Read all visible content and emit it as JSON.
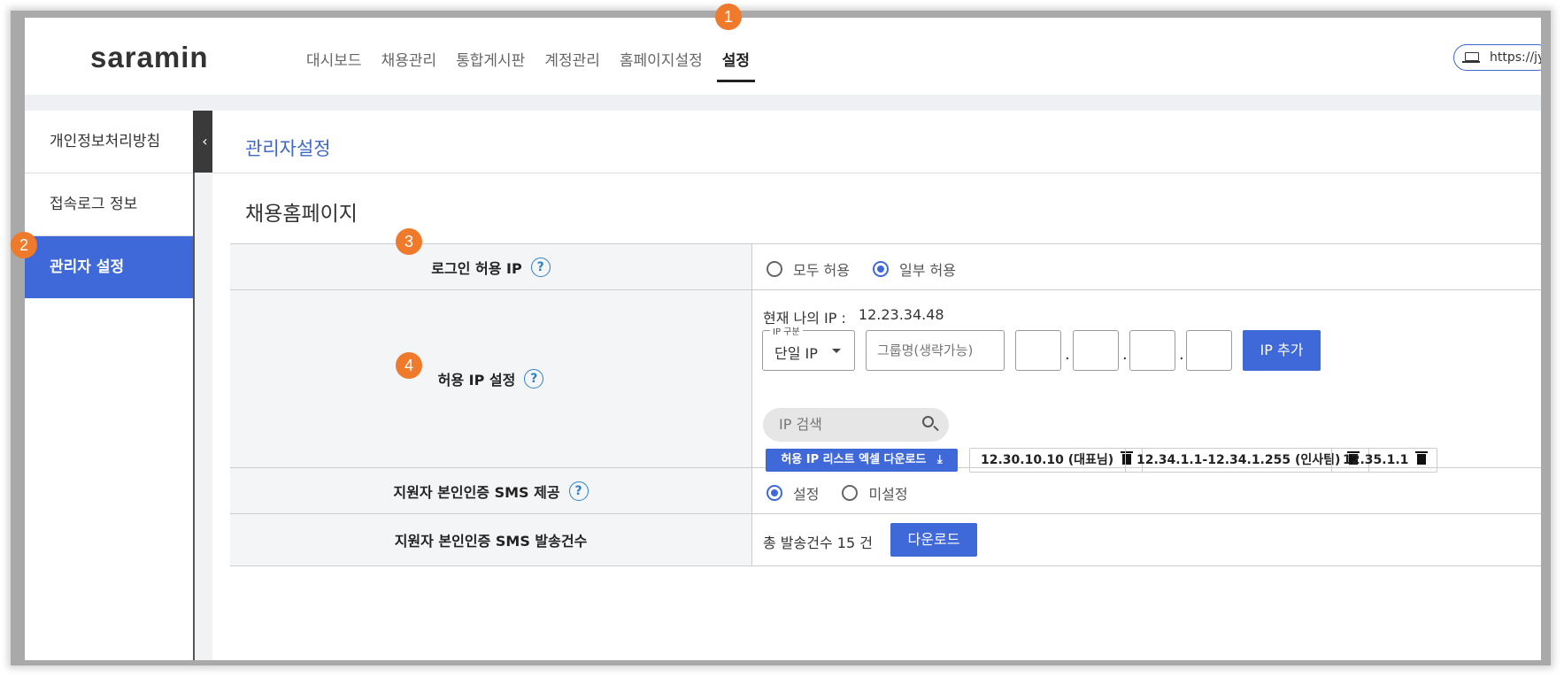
{
  "header": {
    "logo": "saramin",
    "nav": [
      "대시보드",
      "채용관리",
      "통합게시판",
      "계정관리",
      "홈페이지설정",
      "설정"
    ],
    "active_nav": "설정",
    "url": "https://jy"
  },
  "sidebar": {
    "items": [
      "개인정보처리방침",
      "접속로그 정보",
      "관리자 설정"
    ],
    "active": "관리자 설정",
    "collapse_glyph": "‹"
  },
  "main": {
    "breadcrumb": "관리자설정",
    "section_title": "채용홈페이지",
    "rows": {
      "login_ip": {
        "label": "로그인 허용 IP",
        "options": [
          "모두 허용",
          "일부 허용"
        ],
        "selected": "일부 허용"
      },
      "allow_ip": {
        "label": "허용 IP 설정",
        "my_ip_label": "현재 나의 IP :",
        "my_ip_value": "12.23.34.48",
        "ip_type_legend": "IP 구분",
        "ip_type_value": "단일 IP",
        "group_placeholder": "그룹명(생략가능)",
        "add_button": "IP 추가",
        "search_placeholder": "IP 검색",
        "download_button": "허용 IP 리스트 엑셀 다운로드",
        "tags": [
          "12.30.10.10 (대표님)",
          "12.34.1.1-12.34.1.255 (인사팀)",
          "12.35.1.1"
        ]
      },
      "sms": {
        "label": "지원자 본인인증 SMS 제공",
        "options": [
          "설정",
          "미설정"
        ],
        "selected": "설정"
      },
      "sms_count": {
        "label": "지원자 본인인증 SMS 발송건수",
        "text": "총 발송건수 15 건",
        "download_button": "다운로드"
      }
    }
  },
  "annotations": [
    "1",
    "2",
    "3",
    "4"
  ],
  "colors": {
    "accent": "#3f68d9",
    "badge": "#ef7a2c",
    "help": "#2f7fc6"
  },
  "help_glyph": "?"
}
